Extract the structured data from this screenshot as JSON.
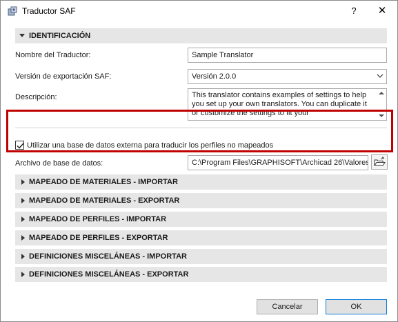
{
  "window": {
    "title": "Traductor SAF",
    "help_label": "?",
    "close_label": "✕"
  },
  "identificacion": {
    "header": "IDENTIFICACIÓN",
    "name_label": "Nombre del Traductor:",
    "name_value": "Sample Translator",
    "version_label": "Versión de exportación SAF:",
    "version_value": "Versión 2.0.0",
    "description_label": "Descripción:",
    "description_value": "This translator contains examples of settings to help you set up your own translators. You can duplicate it or customize the settings to fit your"
  },
  "external_db": {
    "checkbox_label": "Utilizar una base de datos externa para traducir los perfiles no mapeados",
    "checked": true,
    "file_label": "Archivo de base de datos:",
    "file_value": "C:\\Program Files\\GRAPHISOFT\\Archicad 26\\Valores"
  },
  "sections": [
    "MAPEADO DE MATERIALES - IMPORTAR",
    "MAPEADO DE MATERIALES - EXPORTAR",
    "MAPEADO DE PERFILES - IMPORTAR",
    "MAPEADO DE PERFILES - EXPORTAR",
    "DEFINICIONES MISCELÁNEAS - IMPORTAR",
    "DEFINICIONES MISCELÁNEAS - EXPORTAR"
  ],
  "buttons": {
    "cancel": "Cancelar",
    "ok": "OK"
  },
  "colors": {
    "highlight": "#c00000",
    "section_bg": "#e6e6e6",
    "ok_border": "#0078d7"
  }
}
